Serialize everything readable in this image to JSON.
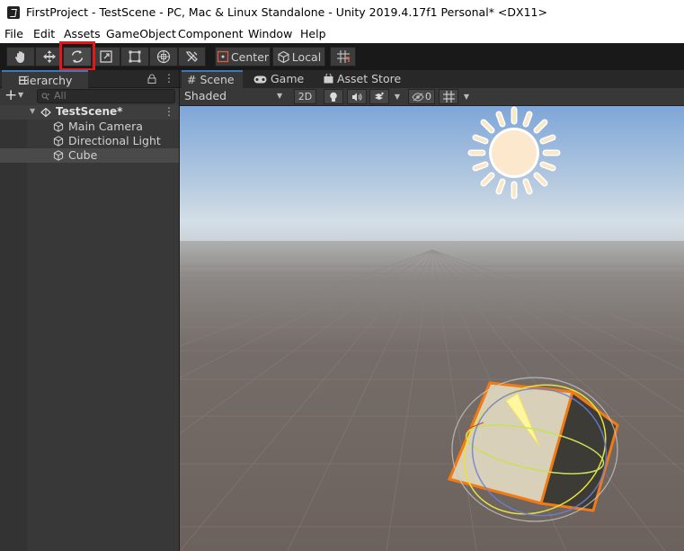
{
  "window": {
    "title": "FirstProject - TestScene - PC, Mac & Linux Standalone - Unity 2019.4.17f1 Personal* <DX11>"
  },
  "menu": [
    "File",
    "Edit",
    "Assets",
    "GameObject",
    "Component",
    "Window",
    "Help"
  ],
  "toolbar": {
    "tools": [
      "hand-tool",
      "move-tool",
      "rotate-tool",
      "scale-tool",
      "rect-tool",
      "transform-tool",
      "custom-tool"
    ],
    "active_tool": "rotate-tool",
    "pivot_label": "Center",
    "space_label": "Local"
  },
  "hierarchy": {
    "tab_label": "Hierarchy",
    "search_placeholder": "All",
    "scene_name": "TestScene*",
    "items": [
      {
        "label": "Main Camera",
        "selected": false
      },
      {
        "label": "Directional Light",
        "selected": false
      },
      {
        "label": "Cube",
        "selected": true
      }
    ]
  },
  "scene": {
    "tabs": [
      "Scene",
      "Game",
      "Asset Store"
    ],
    "active_tab": "Scene",
    "shading_mode": "Shaded",
    "mode_2d": "2D",
    "hidden_count": "0"
  },
  "colors": {
    "highlight": "#e0191c",
    "selection_outline": "#f07a14",
    "active_tab_accent": "#3a79bb",
    "sky_top": "#7ea6d8",
    "ground": "#6e6460"
  }
}
